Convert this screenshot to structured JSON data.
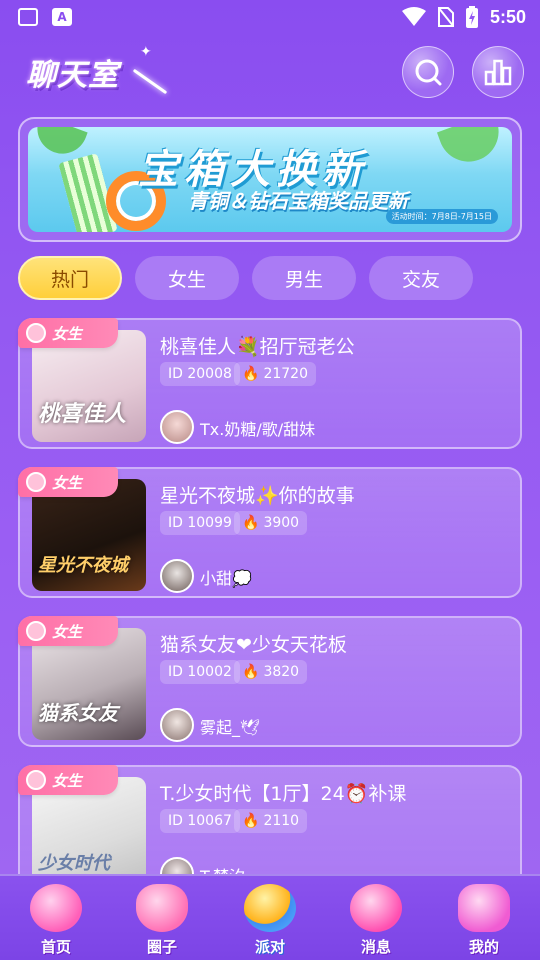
{
  "status_bar": {
    "time": "5:50"
  },
  "header": {
    "app_title": "聊天室"
  },
  "banner": {
    "title": "宝箱大换新",
    "subtitle": "青铜＆钻石宝箱奖品更新",
    "date": "活动时间：7月8日-7月15日"
  },
  "tabs": [
    {
      "label": "热门",
      "active": true
    },
    {
      "label": "女生",
      "active": false
    },
    {
      "label": "男生",
      "active": false
    },
    {
      "label": "交友",
      "active": false
    }
  ],
  "rooms": [
    {
      "tag": "女生",
      "title": "桃喜佳人💐招厅冠老公",
      "id": "ID 20008",
      "heat": "21720",
      "host": "Tx.奶糖/歌/甜妹",
      "thumb_text": "桃喜佳人",
      "thumb_color": "#f3e2ea"
    },
    {
      "tag": "女生",
      "title": "星光不夜城✨你的故事",
      "id": "ID 10099",
      "heat": "3900",
      "host": "小甜💭",
      "thumb_text": "星光不夜城",
      "thumb_color": "#2a1a14"
    },
    {
      "tag": "女生",
      "title": "猫系女友❤少女天花板",
      "id": "ID 10002",
      "heat": "3820",
      "host": "雾起_🕊",
      "thumb_text": "猫系女友",
      "thumb_color": "#d9cfd3"
    },
    {
      "tag": "女生",
      "title": "T.少女时代【1厅】24⏰补课",
      "id": "ID 10067",
      "heat": "2110",
      "host": "T.梦汐",
      "thumb_text": "少女时代",
      "thumb_color": "#ececec"
    }
  ],
  "bottom_nav": [
    {
      "label": "首页",
      "icon": "home-icon",
      "active": false
    },
    {
      "label": "圈子",
      "icon": "circle-icon",
      "active": false
    },
    {
      "label": "派对",
      "icon": "party-icon",
      "active": true
    },
    {
      "label": "消息",
      "icon": "message-icon",
      "active": false
    },
    {
      "label": "我的",
      "icon": "profile-icon",
      "active": false
    }
  ],
  "colors": {
    "accent": "#9358f2",
    "tab_active": "#ffcf3a",
    "tag": "#ff6fa6"
  }
}
